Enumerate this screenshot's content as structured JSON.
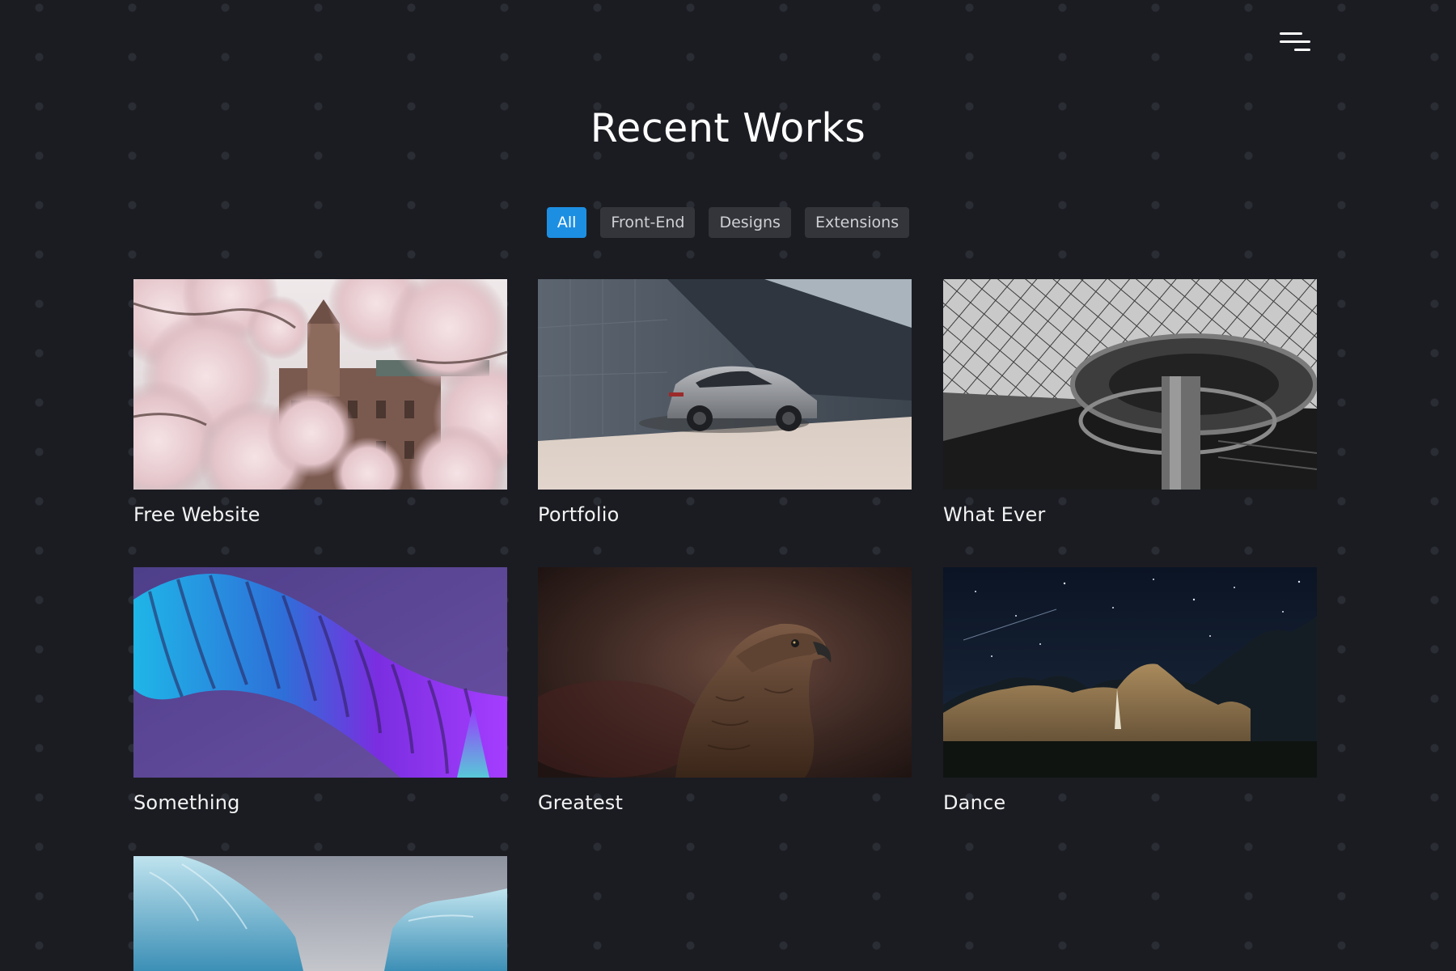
{
  "header": {
    "menu_icon": "hamburger-menu-icon"
  },
  "section": {
    "title": "Recent Works"
  },
  "filters": [
    {
      "label": "All",
      "active": true
    },
    {
      "label": "Front-End",
      "active": false
    },
    {
      "label": "Designs",
      "active": false
    },
    {
      "label": "Extensions",
      "active": false
    }
  ],
  "works": [
    {
      "title": "Free Website",
      "image": "cherry-blossom-building-photo"
    },
    {
      "title": "Portfolio",
      "image": "grey-sports-car-photo"
    },
    {
      "title": "What Ever",
      "image": "glass-pyramid-spiral-stair-photo"
    },
    {
      "title": "Something",
      "image": "purple-blue-abstract-wave-photo"
    },
    {
      "title": "Greatest",
      "image": "eagle-portrait-photo"
    },
    {
      "title": "Dance",
      "image": "night-mountain-waterfall-photo"
    },
    {
      "title": "",
      "image": "glacier-ice-photo"
    }
  ],
  "colors": {
    "background": "#1b1c22",
    "accent": "#1d8fe3",
    "filter_bg": "#34353b"
  }
}
